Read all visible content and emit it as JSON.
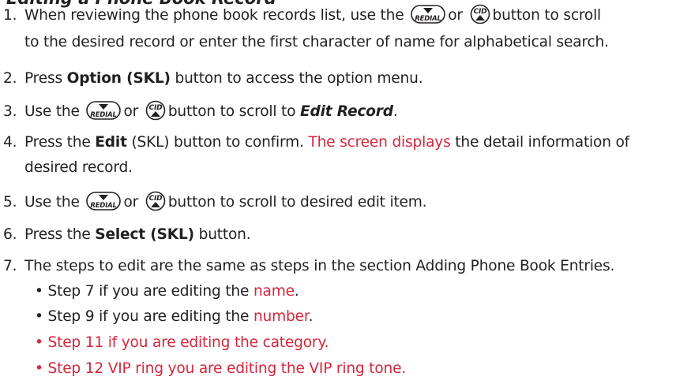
{
  "title": "Editing a Phone Book Record",
  "buttons": {
    "redial": "REDIAL",
    "cid": "CID"
  },
  "step1": {
    "num": "1.",
    "a": "When reviewing the phone book records list, use the",
    "or": "or",
    "b": "button to scroll",
    "c": "to the desired record or enter the first character of name for alphabetical search."
  },
  "step2": {
    "num": "2.",
    "a": "Press",
    "bold": "Option (SKL)",
    "b": "button to access the option menu."
  },
  "step3": {
    "num": "3.",
    "a": "Use the",
    "or": "or",
    "b": "button to scroll to",
    "bold": "Edit Record",
    "c": "."
  },
  "step4": {
    "num": "4.",
    "a": "Press the",
    "bold": "Edit",
    "b": "(SKL) button to confirm.",
    "red": "The screen displays",
    "c": "the detail information of",
    "d": "desired record."
  },
  "step5": {
    "num": "5.",
    "a": "Use the",
    "or": "or",
    "b": "button to scroll to desired edit item."
  },
  "step6": {
    "num": "6.",
    "a": "Press the",
    "bold": "Select (SKL)",
    "b": "button."
  },
  "step7": {
    "num": "7.",
    "a": "The steps to edit are the same as steps in the section Adding Phone Book Entries.",
    "bullets": [
      {
        "pre": "Step 7 if you are editing the",
        "red": "name",
        "post": "."
      },
      {
        "pre": "Step 9 if you are editing the",
        "red": "number",
        "post": "."
      },
      {
        "red": "Step 11 if you are editing the category."
      },
      {
        "red": "Step 12 VIP ring you are editing the VIP ring tone."
      }
    ],
    "bullet_char": "•"
  },
  "colors": {
    "text": "#231f20",
    "accent_red": "#d6263d"
  },
  "icons": [
    "redial-button-icon",
    "cid-button-icon"
  ]
}
